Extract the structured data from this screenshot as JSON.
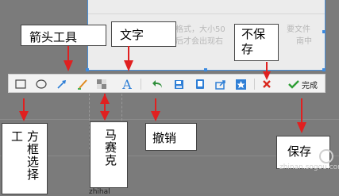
{
  "doc": {
    "line1": "格式，大小50",
    "line1b": "要文件",
    "line2": "后才会出现右",
    "line2b": "南中",
    "footer": "zhihal"
  },
  "toolbar": {
    "rect_icon": "rectangle-icon",
    "ellipse_icon": "ellipse-icon",
    "arrow_icon": "arrow-icon",
    "brush_icon": "brush-icon",
    "mosaic_icon": "mosaic-icon",
    "text_icon": "text-icon",
    "text_glyph": "A",
    "undo_icon": "undo-icon",
    "save_icon": "save-icon",
    "copy_icon": "copy-icon",
    "share_icon": "share-icon",
    "pin_icon": "pin-icon",
    "cancel_icon": "close-icon",
    "done_label": "完成",
    "accent": "#2f7fd6",
    "cancel_color": "#d9261c",
    "done_color": "#2e9e35"
  },
  "annotations": {
    "arrow_tool": "箭头工具",
    "text_tool": "文字",
    "not_save": "不保存",
    "box_select": "方框选择工",
    "mosaic": "马赛克",
    "undo": "撤销",
    "save": "保存",
    "arrow_color": "#e02020"
  },
  "watermark": {
    "url": "zhinan.sogou.com"
  }
}
